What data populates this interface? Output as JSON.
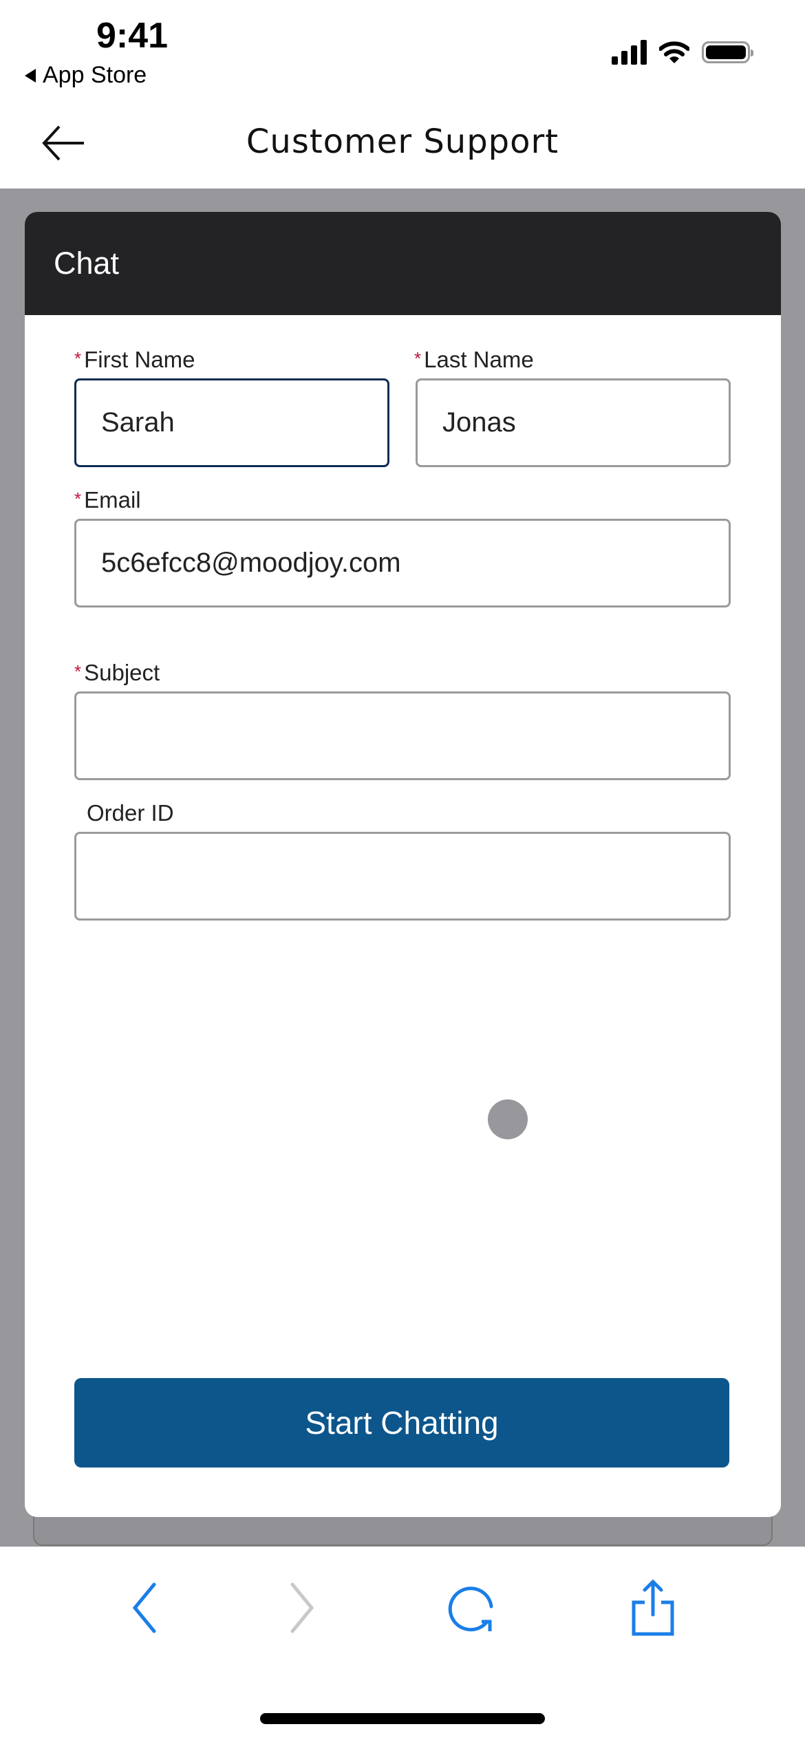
{
  "status_bar": {
    "time": "9:41",
    "back_app": "App Store",
    "icons": [
      "cellular-signal-icon",
      "wifi-icon",
      "battery-icon"
    ]
  },
  "nav": {
    "title": "Customer Support",
    "back_icon": "arrow-left-icon"
  },
  "chat": {
    "title": "Chat",
    "required_marker": "*",
    "fields": {
      "first_name": {
        "label": "First Name",
        "value": "Sarah",
        "required": true
      },
      "last_name": {
        "label": "Last Name",
        "value": "Jonas",
        "required": true
      },
      "email": {
        "label": "Email",
        "value": "5c6efcc8@moodjoy.com",
        "required": true
      },
      "subject": {
        "label": "Subject",
        "value": "",
        "required": true
      },
      "order_id": {
        "label": "Order ID",
        "value": "",
        "required": false
      }
    },
    "submit_label": "Start Chatting"
  },
  "colors": {
    "header": "#232225",
    "button": "#0c568c",
    "required": "#c0143c",
    "toolbar_icon": "#1a7ee8",
    "toolbar_disabled": "#c8c8c8"
  },
  "toolbar": {
    "icons": [
      "chevron-left-icon",
      "chevron-right-icon",
      "reload-icon",
      "share-icon"
    ]
  }
}
